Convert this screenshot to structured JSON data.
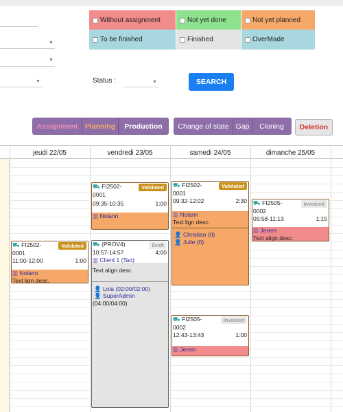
{
  "legend": [
    {
      "label": "Without assignment",
      "color": "#f28b8b"
    },
    {
      "label": "Not yet done",
      "color": "#8ee28e"
    },
    {
      "label": "Not yet planned",
      "color": "#f5a868"
    },
    {
      "label": "To be finished",
      "color": "#a8d7e0"
    },
    {
      "label": "Finished",
      "color": "#e4e4e4"
    },
    {
      "label": "OverMade",
      "color": "#a8d7e0"
    }
  ],
  "status": {
    "label": "Status :",
    "search": "SEARCH"
  },
  "tabs_left": [
    "Assignment",
    "Planning",
    "Production"
  ],
  "tabs_right": [
    "Change of state",
    "Gap",
    "Cloning"
  ],
  "deletion": "Deletion",
  "days": [
    "jeudi 22/05",
    "vendredi 23/05",
    "samedi 24/05",
    "dimanche 25/05"
  ],
  "events": {
    "e1": {
      "code": "FI2502-",
      "code2": "0001",
      "badge": "Validated",
      "time": "11:00-12:00",
      "dur": "1:00",
      "who": "Nolann",
      "desc": "Text lign desc."
    },
    "e2": {
      "code": "FI2502-",
      "code2": "0001",
      "badge": "Validated",
      "time": "09:35-10:35",
      "dur": "1:00",
      "who": "Nolann"
    },
    "e3": {
      "code": "(PROV4)",
      "badge": "Draft",
      "time": "10:57-14:57",
      "dur": "4:00",
      "who": "Client 1 (Tao)",
      "desc": "Text align desc.",
      "p1": "Lola (02:00/02:00)",
      "p2": "SuperAdmin",
      "p3": "(04:00/04:00)"
    },
    "e4": {
      "code": "FI2502-",
      "code2": "0001",
      "badge": "Validated",
      "time": "09:32-12:02",
      "dur": "2:30",
      "who": "Nolann",
      "desc": "Text lign desc.",
      "p1": "Christian (0)",
      "p2": "Julie (0)"
    },
    "e5": {
      "code": "FI2505-",
      "code2": "0002",
      "badge": "Invoiced",
      "time": "12:43-13:43",
      "dur": "1:00",
      "who": "Jerem"
    },
    "e6": {
      "code": "FI2505-",
      "code2": "0002",
      "badge": "Invoiced",
      "time": "09:58-11:13",
      "dur": "1:15",
      "who": "Jerem",
      "desc": "Text align desc."
    }
  },
  "icons": {
    "intervention": "truck-icon",
    "client": "building-icon",
    "user": "user-icon"
  }
}
